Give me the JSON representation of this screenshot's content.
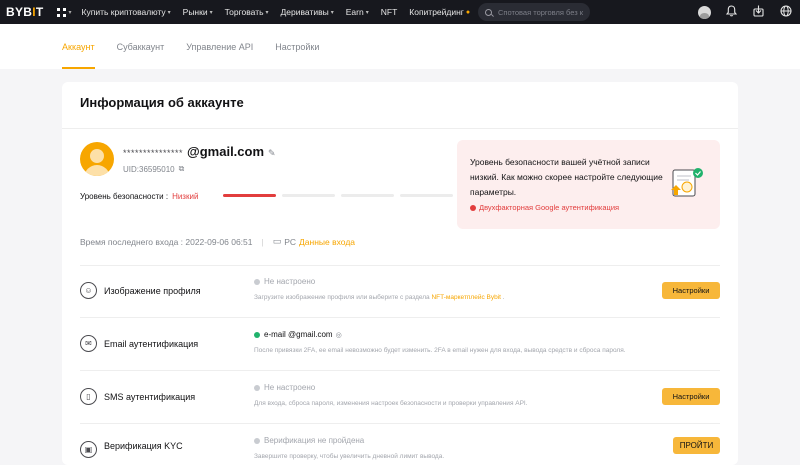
{
  "nav": {
    "logo_pre": "BYB",
    "logo_bar": "I",
    "logo_post": "T",
    "items": [
      {
        "label": "Купить криптовалюту",
        "caret": "▾"
      },
      {
        "label": "Рынки",
        "caret": "▾"
      },
      {
        "label": "Торговать",
        "caret": "▾"
      },
      {
        "label": "Деривативы",
        "caret": "▾"
      },
      {
        "label": "Earn",
        "caret": "▾"
      },
      {
        "label": "NFT",
        "caret": ""
      },
      {
        "label": "Копитрейдинг",
        "caret": ""
      }
    ],
    "search_placeholder": "Спотовая торговля без ком",
    "icons": [
      "avatar-icon",
      "bell-icon",
      "download-icon",
      "globe-icon"
    ]
  },
  "tabs": [
    {
      "label": "Аккаунт",
      "active": true
    },
    {
      "label": "Субаккаунт",
      "active": false
    },
    {
      "label": "Управление API",
      "active": false
    },
    {
      "label": "Настройки",
      "active": false
    }
  ],
  "account": {
    "title": "Информация об аккаунте",
    "email_mask": "***************",
    "email_domain": "@gmail.com",
    "uid": "UID:36595010",
    "security_label": "Уровень безопасности :",
    "security_value": "Низкий",
    "security_level": 1,
    "security_total": 4,
    "last_login_label": "Время последнего входа : 2022-09-06 06:51",
    "device": "PC",
    "login_link": "Данные входа"
  },
  "warning": {
    "text": "Уровень безопасности вашей учётной записи низкий. Как можно скорее настройте следующие параметры.",
    "link": "Двухфакторная Google аутентификация"
  },
  "rows": [
    {
      "label": "Изображение профиля",
      "status": "Не настроено",
      "status_ok": false,
      "desc": "Загрузите изображение профиля или выберите с раздела ",
      "desc_link": "NFT-маркетплейс Bybit",
      "desc_tail": " .",
      "button": "Настройки"
    },
    {
      "label": "Email аутентификация",
      "status": "e-mail  @gmail.com",
      "status_ok": true,
      "desc": "После привязки 2FA, ее email невозможно будет изменить. 2FA в email нужен для входа, вывода средств и сброса пароля.",
      "desc_link": "",
      "desc_tail": "",
      "button": ""
    },
    {
      "label": "SMS аутентификация",
      "status": "Не настроено",
      "status_ok": false,
      "desc": "Для входа, сброса пароля, изменения настроек безопасности и проверки управления API.",
      "desc_link": "",
      "desc_tail": "",
      "button": "Настройки"
    },
    {
      "label": "Верификация KYC",
      "status": "Верификация не пройдена",
      "status_ok": false,
      "desc": "Завершите проверку, чтобы увеличить дневной лимит вывода.",
      "desc_link": "",
      "desc_tail": "",
      "button": "ПРОЙТИ"
    }
  ],
  "colors": {
    "accent": "#f7a600",
    "danger": "#e23d3d",
    "success": "#20b26c",
    "nav_bg": "#17181e"
  }
}
